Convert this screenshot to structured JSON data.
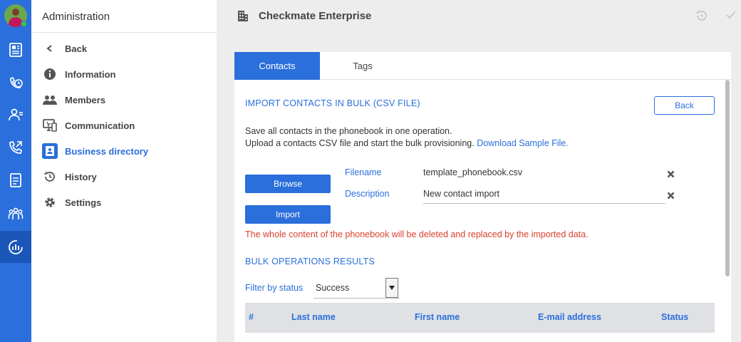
{
  "rail": {
    "items": [
      {
        "icon": "newspaper-icon"
      },
      {
        "icon": "phone-clock-icon"
      },
      {
        "icon": "contacts-icon"
      },
      {
        "icon": "phone-forward-icon"
      },
      {
        "icon": "report-icon"
      },
      {
        "icon": "groups-icon"
      },
      {
        "icon": "analytics-icon",
        "active": true
      }
    ]
  },
  "sidebar": {
    "title": "Administration",
    "items": [
      {
        "label": "Back",
        "icon": "chevron-left-icon"
      },
      {
        "label": "Information",
        "icon": "info-icon"
      },
      {
        "label": "Members",
        "icon": "members-icon"
      },
      {
        "label": "Communication",
        "icon": "communication-icon"
      },
      {
        "label": "Business directory",
        "icon": "directory-icon",
        "active": true
      },
      {
        "label": "History",
        "icon": "history-icon"
      },
      {
        "label": "Settings",
        "icon": "gear-icon"
      }
    ]
  },
  "header": {
    "title": "Checkmate Enterprise"
  },
  "tabs": [
    {
      "label": "Contacts",
      "active": true
    },
    {
      "label": "Tags"
    }
  ],
  "import": {
    "title": "IMPORT CONTACTS IN BULK (CSV FILE)",
    "back_label": "Back",
    "desc_line1": "Save all contacts in the phonebook in one operation.",
    "desc_line2": "Upload a contacts CSV file and start the bulk provisioning.",
    "sample_link": "Download Sample File.",
    "browse_label": "Browse",
    "import_label": "Import",
    "filename_label": "Filename",
    "filename_value": "template_phonebook.csv",
    "description_label": "Description",
    "description_value": "New contact import",
    "warning": "The whole content of the phonebook will be deleted and replaced by the imported data."
  },
  "results": {
    "title": "BULK OPERATIONS RESULTS",
    "filter_label": "Filter by status",
    "filter_value": "Success",
    "columns": [
      "#",
      "Last name",
      "First name",
      "E-mail address",
      "Status"
    ]
  },
  "colors": {
    "accent": "#2a6fdb",
    "warning": "#d9412b"
  }
}
